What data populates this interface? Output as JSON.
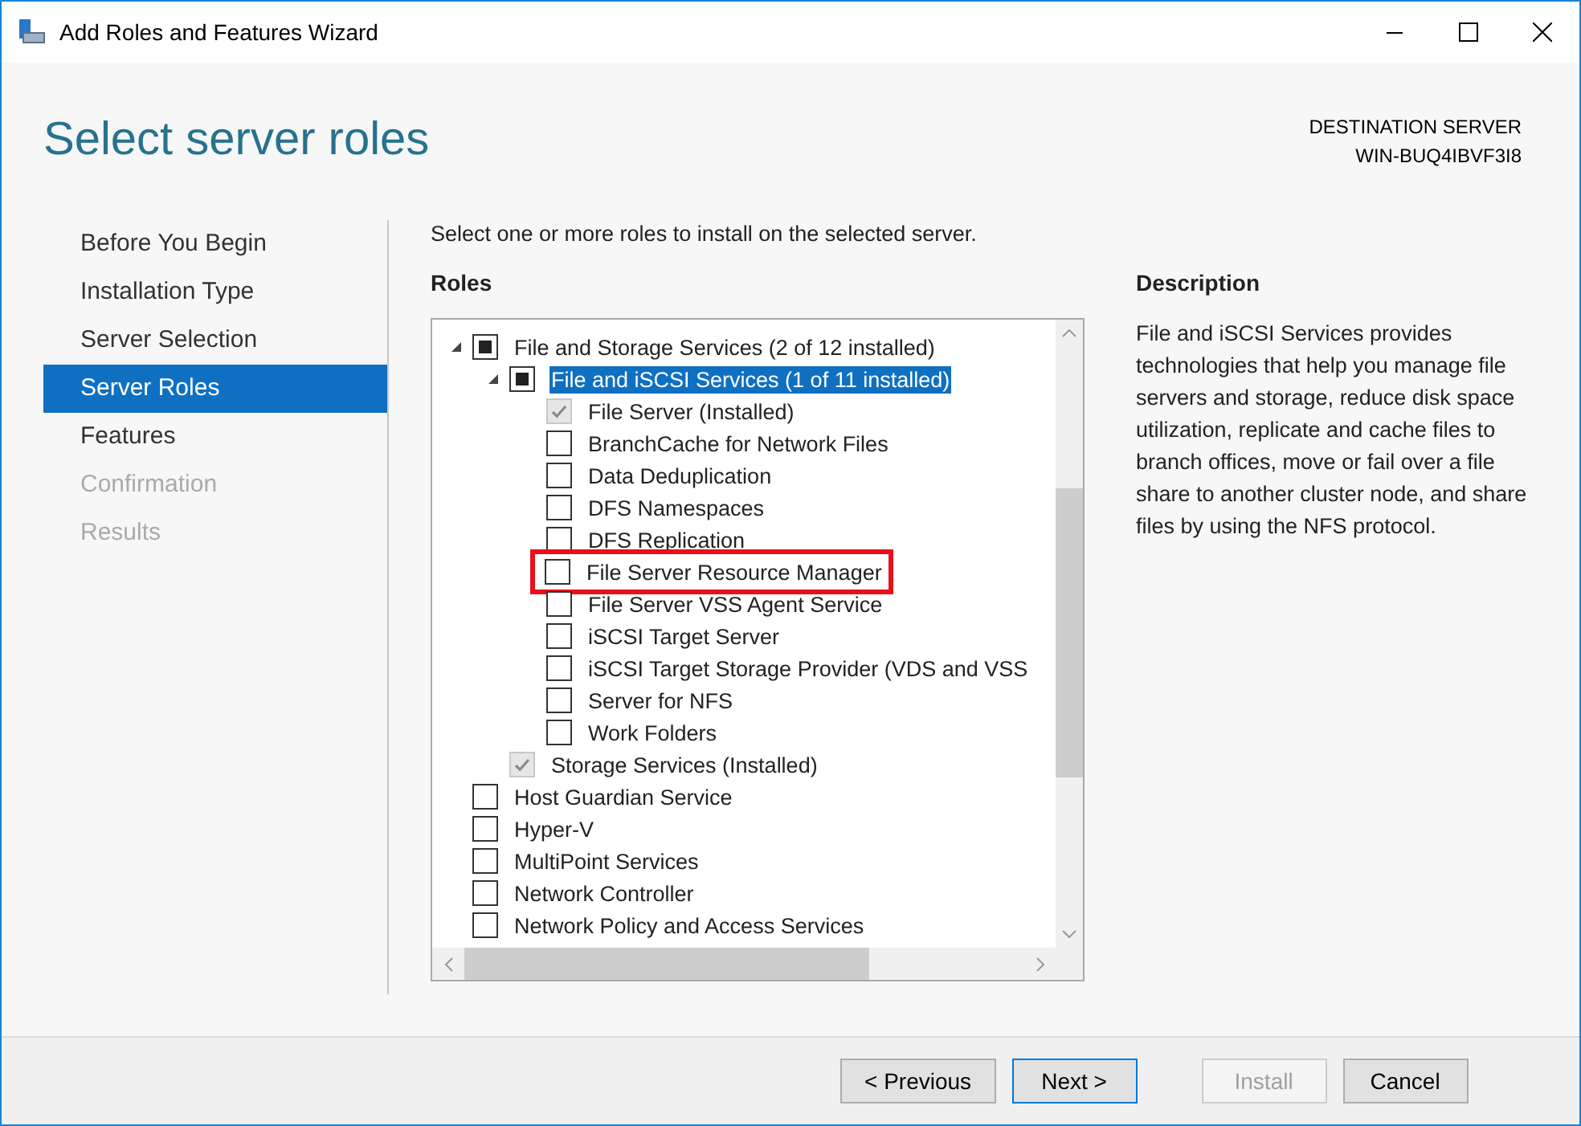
{
  "window": {
    "title": "Add Roles and Features Wizard"
  },
  "header": {
    "title": "Select server roles",
    "destination_label": "DESTINATION SERVER",
    "destination_name": "WIN-BUQ4IBVF3I8"
  },
  "sidebar": {
    "items": [
      {
        "label": "Before You Begin",
        "selected": false,
        "disabled": false
      },
      {
        "label": "Installation Type",
        "selected": false,
        "disabled": false
      },
      {
        "label": "Server Selection",
        "selected": false,
        "disabled": false
      },
      {
        "label": "Server Roles",
        "selected": true,
        "disabled": false
      },
      {
        "label": "Features",
        "selected": false,
        "disabled": false
      },
      {
        "label": "Confirmation",
        "selected": false,
        "disabled": true
      },
      {
        "label": "Results",
        "selected": false,
        "disabled": true
      }
    ]
  },
  "intro": "Select one or more roles to install on the selected server.",
  "roles": {
    "heading": "Roles",
    "items": [
      {
        "label": "File and Storage Services (2 of 12 installed)",
        "expanded": true,
        "checked": false,
        "indeterminate": true,
        "disabled": false,
        "selected": false,
        "highlighted": false,
        "children": [
          {
            "label": "File and iSCSI Services (1 of 11 installed)",
            "expanded": true,
            "checked": false,
            "indeterminate": true,
            "disabled": false,
            "selected": true,
            "highlighted": false,
            "children": [
              {
                "label": "File Server (Installed)",
                "checked": true,
                "indeterminate": false,
                "disabled": true,
                "selected": false,
                "highlighted": false
              },
              {
                "label": "BranchCache for Network Files",
                "checked": false,
                "indeterminate": false,
                "disabled": false,
                "selected": false,
                "highlighted": false
              },
              {
                "label": "Data Deduplication",
                "checked": false,
                "indeterminate": false,
                "disabled": false,
                "selected": false,
                "highlighted": false
              },
              {
                "label": "DFS Namespaces",
                "checked": false,
                "indeterminate": false,
                "disabled": false,
                "selected": false,
                "highlighted": false
              },
              {
                "label": "DFS Replication",
                "checked": false,
                "indeterminate": false,
                "disabled": false,
                "selected": false,
                "highlighted": false
              },
              {
                "label": "File Server Resource Manager",
                "checked": false,
                "indeterminate": false,
                "disabled": false,
                "selected": false,
                "highlighted": true
              },
              {
                "label": "File Server VSS Agent Service",
                "checked": false,
                "indeterminate": false,
                "disabled": false,
                "selected": false,
                "highlighted": false
              },
              {
                "label": "iSCSI Target Server",
                "checked": false,
                "indeterminate": false,
                "disabled": false,
                "selected": false,
                "highlighted": false
              },
              {
                "label": "iSCSI Target Storage Provider (VDS and VSS",
                "checked": false,
                "indeterminate": false,
                "disabled": false,
                "selected": false,
                "highlighted": false
              },
              {
                "label": "Server for NFS",
                "checked": false,
                "indeterminate": false,
                "disabled": false,
                "selected": false,
                "highlighted": false
              },
              {
                "label": "Work Folders",
                "checked": false,
                "indeterminate": false,
                "disabled": false,
                "selected": false,
                "highlighted": false
              }
            ]
          },
          {
            "label": "Storage Services (Installed)",
            "checked": true,
            "indeterminate": false,
            "disabled": true,
            "selected": false,
            "highlighted": false
          }
        ]
      },
      {
        "label": "Host Guardian Service",
        "checked": false,
        "indeterminate": false,
        "disabled": false,
        "selected": false,
        "highlighted": false
      },
      {
        "label": "Hyper-V",
        "checked": false,
        "indeterminate": false,
        "disabled": false,
        "selected": false,
        "highlighted": false
      },
      {
        "label": "MultiPoint Services",
        "checked": false,
        "indeterminate": false,
        "disabled": false,
        "selected": false,
        "highlighted": false
      },
      {
        "label": "Network Controller",
        "checked": false,
        "indeterminate": false,
        "disabled": false,
        "selected": false,
        "highlighted": false
      },
      {
        "label": "Network Policy and Access Services",
        "checked": false,
        "indeterminate": false,
        "disabled": false,
        "selected": false,
        "highlighted": false
      }
    ]
  },
  "description": {
    "heading": "Description",
    "text": "File and iSCSI Services provides technologies that help you manage file servers and storage, reduce disk space utilization, replicate and cache files to branch offices, move or fail over a file share to another cluster node, and share files by using the NFS protocol."
  },
  "buttons": [
    {
      "label": "< Previous",
      "disabled": false,
      "default": false
    },
    {
      "label": "Next >",
      "disabled": false,
      "default": true
    },
    {
      "label": "Install",
      "disabled": true,
      "default": false
    },
    {
      "label": "Cancel",
      "disabled": false,
      "default": false
    }
  ]
}
